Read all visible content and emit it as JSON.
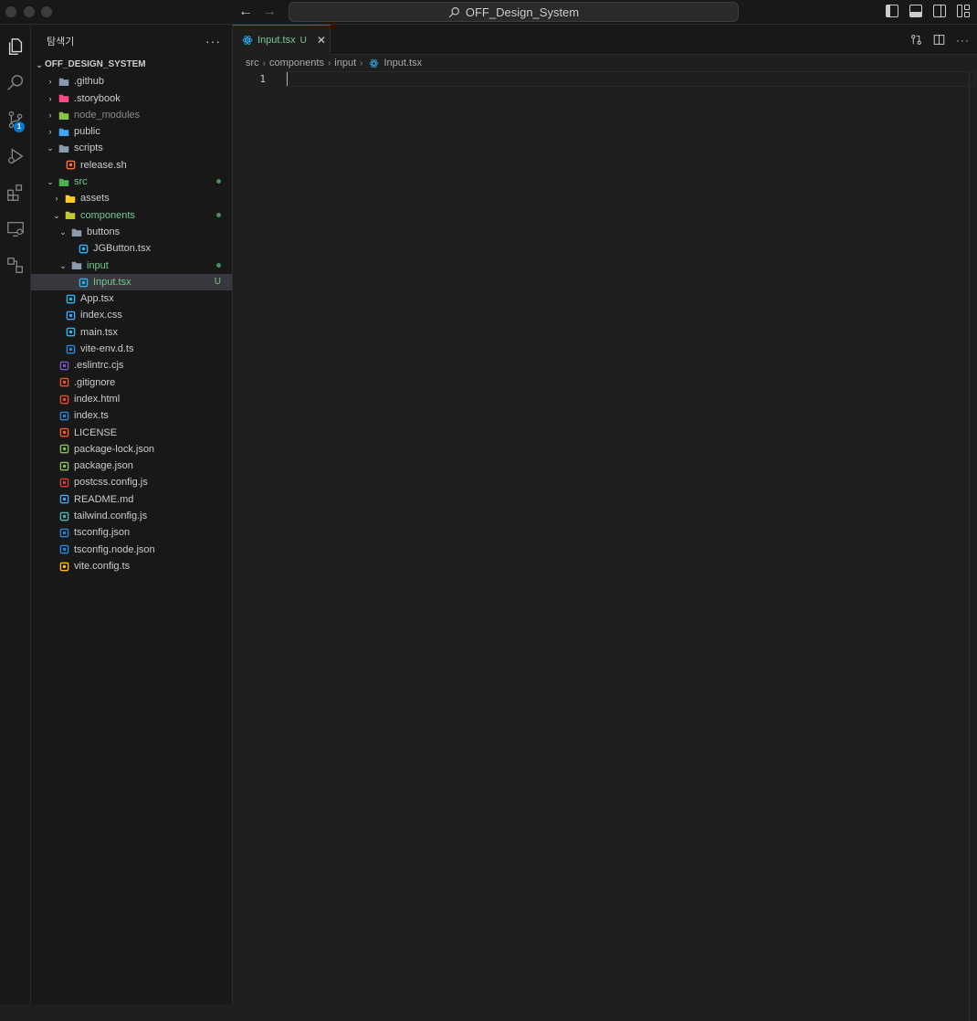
{
  "titlebar": {
    "search_text": "OFF_Design_System"
  },
  "activity_bar": {
    "items": [
      "explorer-icon",
      "search-icon",
      "source-control-icon",
      "run-debug-icon",
      "extensions-icon",
      "remote-explorer-icon",
      "other-views-icon"
    ],
    "source_control_badge": "1"
  },
  "sidebar": {
    "title": "탐색기",
    "more": "···",
    "project": "OFF_DESIGN_SYSTEM",
    "tree": [
      {
        "label": ".github",
        "depth": 1,
        "type": "folder",
        "icon_color": "#8a9bb0"
      },
      {
        "label": ".storybook",
        "depth": 1,
        "type": "folder",
        "icon_color": "#ff4785"
      },
      {
        "label": "node_modules",
        "depth": 1,
        "type": "folder",
        "icon_color": "#8bc34a",
        "dim": true
      },
      {
        "label": "public",
        "depth": 1,
        "type": "folder",
        "icon_color": "#42a5f5"
      },
      {
        "label": "scripts",
        "depth": 1,
        "type": "folder-open",
        "icon_color": "#8a9bb0"
      },
      {
        "label": "release.sh",
        "depth": 2,
        "type": "file",
        "icon_color": "#ff7043"
      },
      {
        "label": "src",
        "depth": 1,
        "type": "folder-open",
        "icon_color": "#4caf50",
        "modified": true,
        "deco": "dot"
      },
      {
        "label": "assets",
        "depth": 2,
        "type": "folder",
        "icon_color": "#ffca28"
      },
      {
        "label": "components",
        "depth": 2,
        "type": "folder-open",
        "icon_color": "#c0ca33",
        "modified": true,
        "deco": "dot"
      },
      {
        "label": "buttons",
        "depth": 3,
        "type": "folder-open",
        "icon_color": "#8a9bb0"
      },
      {
        "label": "JGButton.tsx",
        "depth": 4,
        "type": "file",
        "icon_color": "#29b6f6"
      },
      {
        "label": "input",
        "depth": 3,
        "type": "folder-open",
        "icon_color": "#8a9bb0",
        "modified": true,
        "deco": "dot"
      },
      {
        "label": "Input.tsx",
        "depth": 4,
        "type": "file",
        "icon_color": "#29b6f6",
        "modified": true,
        "deco": "U",
        "selected": true
      },
      {
        "label": "App.tsx",
        "depth": 2,
        "type": "file",
        "icon_color": "#29b6f6"
      },
      {
        "label": "index.css",
        "depth": 2,
        "type": "file",
        "icon_color": "#42a5f5"
      },
      {
        "label": "main.tsx",
        "depth": 2,
        "type": "file",
        "icon_color": "#29b6f6"
      },
      {
        "label": "vite-env.d.ts",
        "depth": 2,
        "type": "file",
        "icon_color": "#1e88e5"
      },
      {
        "label": ".eslintrc.cjs",
        "depth": 1,
        "type": "file",
        "icon_color": "#7e57c2"
      },
      {
        "label": ".gitignore",
        "depth": 1,
        "type": "file",
        "icon_color": "#f4511e"
      },
      {
        "label": "index.html",
        "depth": 1,
        "type": "file",
        "icon_color": "#e44d26"
      },
      {
        "label": "index.ts",
        "depth": 1,
        "type": "file",
        "icon_color": "#1e88e5"
      },
      {
        "label": "LICENSE",
        "depth": 1,
        "type": "file",
        "icon_color": "#ff5722"
      },
      {
        "label": "package-lock.json",
        "depth": 1,
        "type": "file",
        "icon_color": "#8bc34a"
      },
      {
        "label": "package.json",
        "depth": 1,
        "type": "file",
        "icon_color": "#8bc34a"
      },
      {
        "label": "postcss.config.js",
        "depth": 1,
        "type": "file",
        "icon_color": "#e53935"
      },
      {
        "label": "README.md",
        "depth": 1,
        "type": "file",
        "icon_color": "#42a5f5"
      },
      {
        "label": "tailwind.config.js",
        "depth": 1,
        "type": "file",
        "icon_color": "#4db6ac"
      },
      {
        "label": "tsconfig.json",
        "depth": 1,
        "type": "file",
        "icon_color": "#1e88e5"
      },
      {
        "label": "tsconfig.node.json",
        "depth": 1,
        "type": "file",
        "icon_color": "#1e88e5"
      },
      {
        "label": "vite.config.ts",
        "depth": 1,
        "type": "file",
        "icon_color": "#ffc107"
      }
    ]
  },
  "editor": {
    "tab": {
      "label": "Input.tsx",
      "status": "U",
      "close": "✕"
    },
    "breadcrumb": [
      "src",
      "components",
      "input",
      "Input.tsx"
    ],
    "line_numbers": [
      "1"
    ]
  },
  "colors": {
    "accent": "#0078d4",
    "untracked": "#73c991"
  }
}
